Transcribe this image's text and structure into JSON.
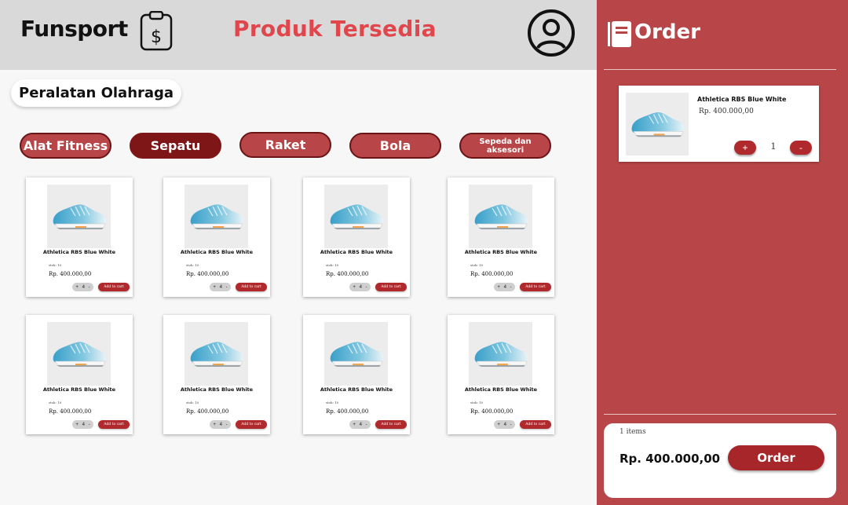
{
  "header": {
    "brand": "Funsport",
    "title": "Produk Tersedia",
    "bill_icon": "bill-dollar-icon",
    "user_icon": "user-circle-icon"
  },
  "section": {
    "label": "Peralatan Olahraga"
  },
  "categories": [
    {
      "label": "Alat Fitness",
      "active": false
    },
    {
      "label": "Sepatu",
      "active": true
    },
    {
      "label": "Raket",
      "active": false
    },
    {
      "label": "Bola",
      "active": false
    },
    {
      "label": "Sepeda dan aksesori",
      "active": false
    }
  ],
  "products": [
    {
      "name": "Athletica RBS Blue White",
      "stock": "stok: 10",
      "price": "Rp. 400.000,00",
      "qty": "4",
      "plus": "+",
      "minus": "-",
      "add_label": "Add to cart"
    },
    {
      "name": "Athletica RBS Blue White",
      "stock": "stok: 10",
      "price": "Rp. 400.000,00",
      "qty": "4",
      "plus": "+",
      "minus": "-",
      "add_label": "Add to cart"
    },
    {
      "name": "Athletica RBS Blue White",
      "stock": "stok: 10",
      "price": "Rp. 400.000,00",
      "qty": "4",
      "plus": "+",
      "minus": "-",
      "add_label": "Add to cart"
    },
    {
      "name": "Athletica RBS Blue White",
      "stock": "stok: 10",
      "price": "Rp. 400.000,00",
      "qty": "4",
      "plus": "+",
      "minus": "-",
      "add_label": "Add to cart"
    },
    {
      "name": "Athletica RBS Blue White",
      "stock": "stok: 10",
      "price": "Rp. 400.000,00",
      "qty": "4",
      "plus": "+",
      "minus": "-",
      "add_label": "Add to cart"
    },
    {
      "name": "Athletica RBS Blue White",
      "stock": "stok: 10",
      "price": "Rp. 400.000,00",
      "qty": "4",
      "plus": "+",
      "minus": "-",
      "add_label": "Add to cart"
    },
    {
      "name": "Athletica RBS Blue White",
      "stock": "stok: 10",
      "price": "Rp. 400.000,00",
      "qty": "4",
      "plus": "+",
      "minus": "-",
      "add_label": "Add to cart"
    },
    {
      "name": "Athletica RBS Blue White",
      "stock": "stok: 10",
      "price": "Rp. 400.000,00",
      "qty": "4",
      "plus": "+",
      "minus": "-",
      "add_label": "Add to cart"
    }
  ],
  "order": {
    "title": "Order",
    "icon": "notebook-icon",
    "items": [
      {
        "name": "Athletica RBS Blue White",
        "price": "Rp. 400.000,00",
        "qty": "1",
        "plus": "+",
        "minus": "-"
      }
    ],
    "summary": {
      "count": "1 items",
      "total": "Rp. 400.000,00",
      "button": "Order"
    }
  },
  "colors": {
    "accent": "#b84547",
    "title_red": "#e0474c",
    "button_red": "#b02a2d",
    "active_category": "#7e1517",
    "topbar": "#d9d9d9"
  }
}
